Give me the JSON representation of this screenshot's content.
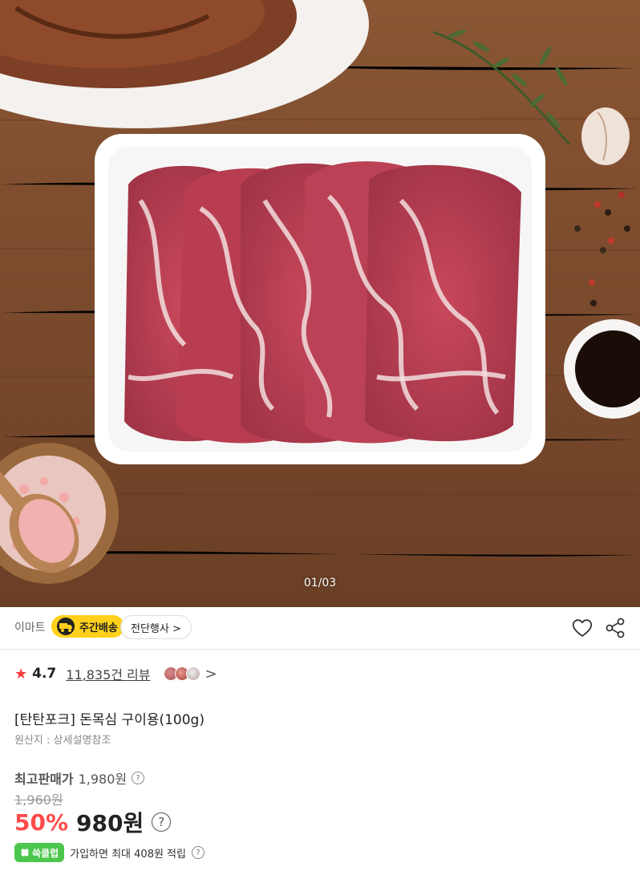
{
  "gallery": {
    "counter": "01/03"
  },
  "seller": {
    "brand": "이마트",
    "shipping_badge": "주간배송",
    "event_label": "전단행사 >",
    "icons": {
      "wish": "heart-icon",
      "share": "share-icon",
      "shipping": "truck-icon"
    }
  },
  "rating": {
    "score": "4.7",
    "review_count": "11,835건 리뷰",
    "chevron": ">"
  },
  "product": {
    "title": "[탄탄포크] 돈목심 구이용(100g)",
    "origin": "원산지 : 상세설명참조"
  },
  "pricing": {
    "top_label": "최고판매가",
    "top_value": "1,980원",
    "original_price": "1,960원",
    "discount": "50%",
    "sale_price": "980원",
    "help_glyph": "?"
  },
  "club": {
    "badge": "쓱클럽",
    "text": "가입하면 최대 408원 적립"
  },
  "colors": {
    "accent_red": "#ff4b4b",
    "shipping_yellow": "#ffd11a",
    "club_green": "#4cc64c"
  }
}
